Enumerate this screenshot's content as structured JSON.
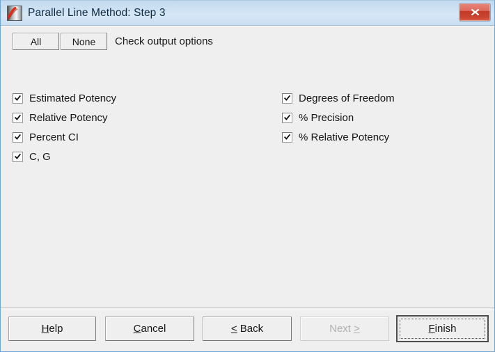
{
  "window": {
    "title": "Parallel Line Method: Step 3",
    "app_icon": "parallel-line-chart-icon",
    "close_icon": "close-icon",
    "accent_title_bar": "#cfe2f3",
    "close_button_color": "#c33a28",
    "dialog_background": "#efefef"
  },
  "toolbar": {
    "all_label": "All",
    "none_label": "None",
    "instruction": "Check output options"
  },
  "options": {
    "left_column": [
      {
        "label": "Estimated Potency",
        "checked": true
      },
      {
        "label": "Relative Potency",
        "checked": true
      },
      {
        "label": "Percent CI",
        "checked": true
      },
      {
        "label": "C, G",
        "checked": true
      }
    ],
    "right_column": [
      {
        "label": "Degrees of Freedom",
        "checked": true
      },
      {
        "label": "% Precision",
        "checked": true
      },
      {
        "label": "% Relative Potency",
        "checked": true
      }
    ]
  },
  "footer": {
    "help": {
      "pre": "",
      "mnemonic": "H",
      "post": "elp",
      "enabled": true
    },
    "cancel": {
      "pre": "",
      "mnemonic": "C",
      "post": "ancel",
      "enabled": true
    },
    "back": {
      "pre": "",
      "mnemonic": "<",
      "post": " Back",
      "enabled": true
    },
    "next": {
      "pre": "Next ",
      "mnemonic": ">",
      "post": "",
      "enabled": false
    },
    "finish": {
      "pre": "",
      "mnemonic": "F",
      "post": "inish",
      "enabled": true,
      "default": true
    }
  }
}
